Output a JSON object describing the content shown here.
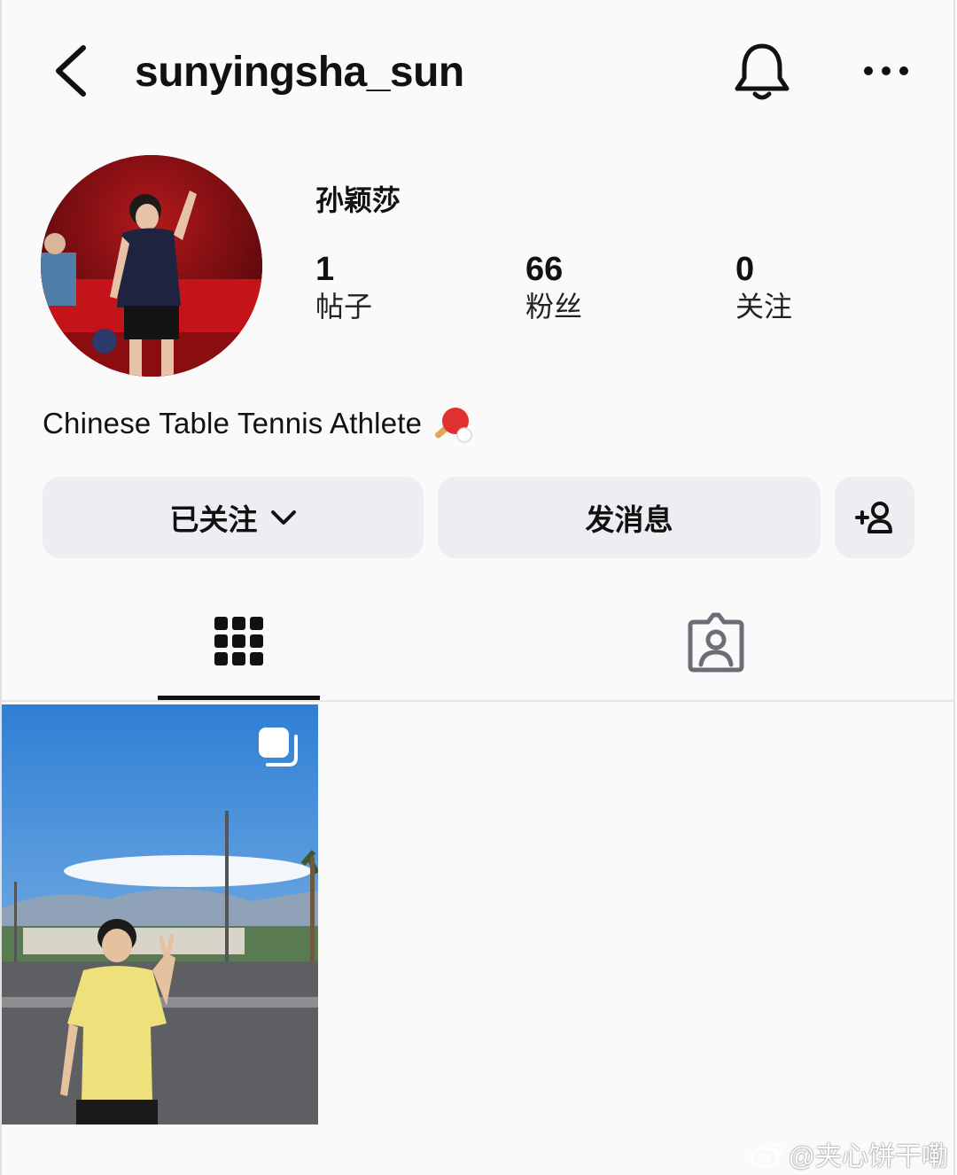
{
  "header": {
    "username": "sunyingsha_sun"
  },
  "profile": {
    "display_name": "孙颖莎",
    "stats": [
      {
        "value": "1",
        "label": "帖子"
      },
      {
        "value": "66",
        "label": "粉丝"
      },
      {
        "value": "0",
        "label": "关注"
      }
    ],
    "bio": "Chinese Table Tennis Athlete",
    "bio_emoji": "ping-pong-icon"
  },
  "actions": {
    "following_label": "已关注",
    "message_label": "发消息",
    "add_user_icon": "add-user-icon"
  },
  "tabs": [
    {
      "name": "grid",
      "icon": "grid-icon",
      "active": true
    },
    {
      "name": "tagged",
      "icon": "tagged-person-icon",
      "active": false
    }
  ],
  "posts": [
    {
      "type": "carousel",
      "icon": "multiple-photos-icon"
    }
  ],
  "watermark": {
    "text": "@夹心饼干嘞",
    "icon": "weibo-icon"
  },
  "colors": {
    "background": "#fafafa",
    "button_bg": "#eceef1",
    "text": "#111111"
  }
}
